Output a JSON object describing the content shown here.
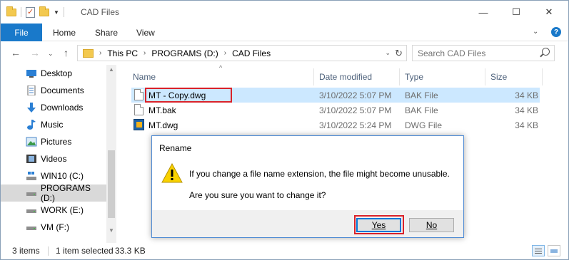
{
  "window": {
    "title": "CAD Files",
    "controls": {
      "minimize": "—",
      "maximize": "☐",
      "close": "✕"
    }
  },
  "ribbon": {
    "tabs": [
      "File",
      "Home",
      "Share",
      "View"
    ]
  },
  "address": {
    "segments": [
      "This PC",
      "PROGRAMS (D:)",
      "CAD Files"
    ]
  },
  "search": {
    "placeholder": "Search CAD Files"
  },
  "sidebar": {
    "items": [
      {
        "label": "Desktop",
        "icon": "desktop-icon"
      },
      {
        "label": "Documents",
        "icon": "documents-icon"
      },
      {
        "label": "Downloads",
        "icon": "downloads-icon"
      },
      {
        "label": "Music",
        "icon": "music-icon"
      },
      {
        "label": "Pictures",
        "icon": "pictures-icon"
      },
      {
        "label": "Videos",
        "icon": "videos-icon"
      },
      {
        "label": "WIN10 (C:)",
        "icon": "windows-drive-icon"
      },
      {
        "label": "PROGRAMS (D:)",
        "icon": "drive-icon",
        "selected": true
      },
      {
        "label": "WORK (E:)",
        "icon": "drive-icon"
      },
      {
        "label": "VM (F:)",
        "icon": "drive-icon"
      }
    ]
  },
  "columns": {
    "name": "Name",
    "date": "Date modified",
    "type": "Type",
    "size": "Size"
  },
  "files": [
    {
      "name": "MT - Copy.dwg",
      "date": "3/10/2022 5:07 PM",
      "type": "BAK File",
      "size": "34 KB",
      "selected": true,
      "icon": "blank-file-icon"
    },
    {
      "name": "MT.bak",
      "date": "3/10/2022 5:07 PM",
      "type": "BAK File",
      "size": "34 KB",
      "icon": "blank-file-icon"
    },
    {
      "name": "MT.dwg",
      "date": "3/10/2022 5:24 PM",
      "type": "DWG File",
      "size": "34 KB",
      "icon": "dwg-file-icon"
    }
  ],
  "status": {
    "count": "3 items",
    "selected": "1 item selected",
    "size": "33.3 KB"
  },
  "dialog": {
    "title": "Rename",
    "message": "If you change a file name extension, the file might become unusable.",
    "question": "Are you sure you want to change it?",
    "yes_label": "Yes",
    "no_label": "No"
  },
  "colors": {
    "accent": "#1979ca",
    "selection": "#cce8ff",
    "highlight": "#d9222a"
  }
}
